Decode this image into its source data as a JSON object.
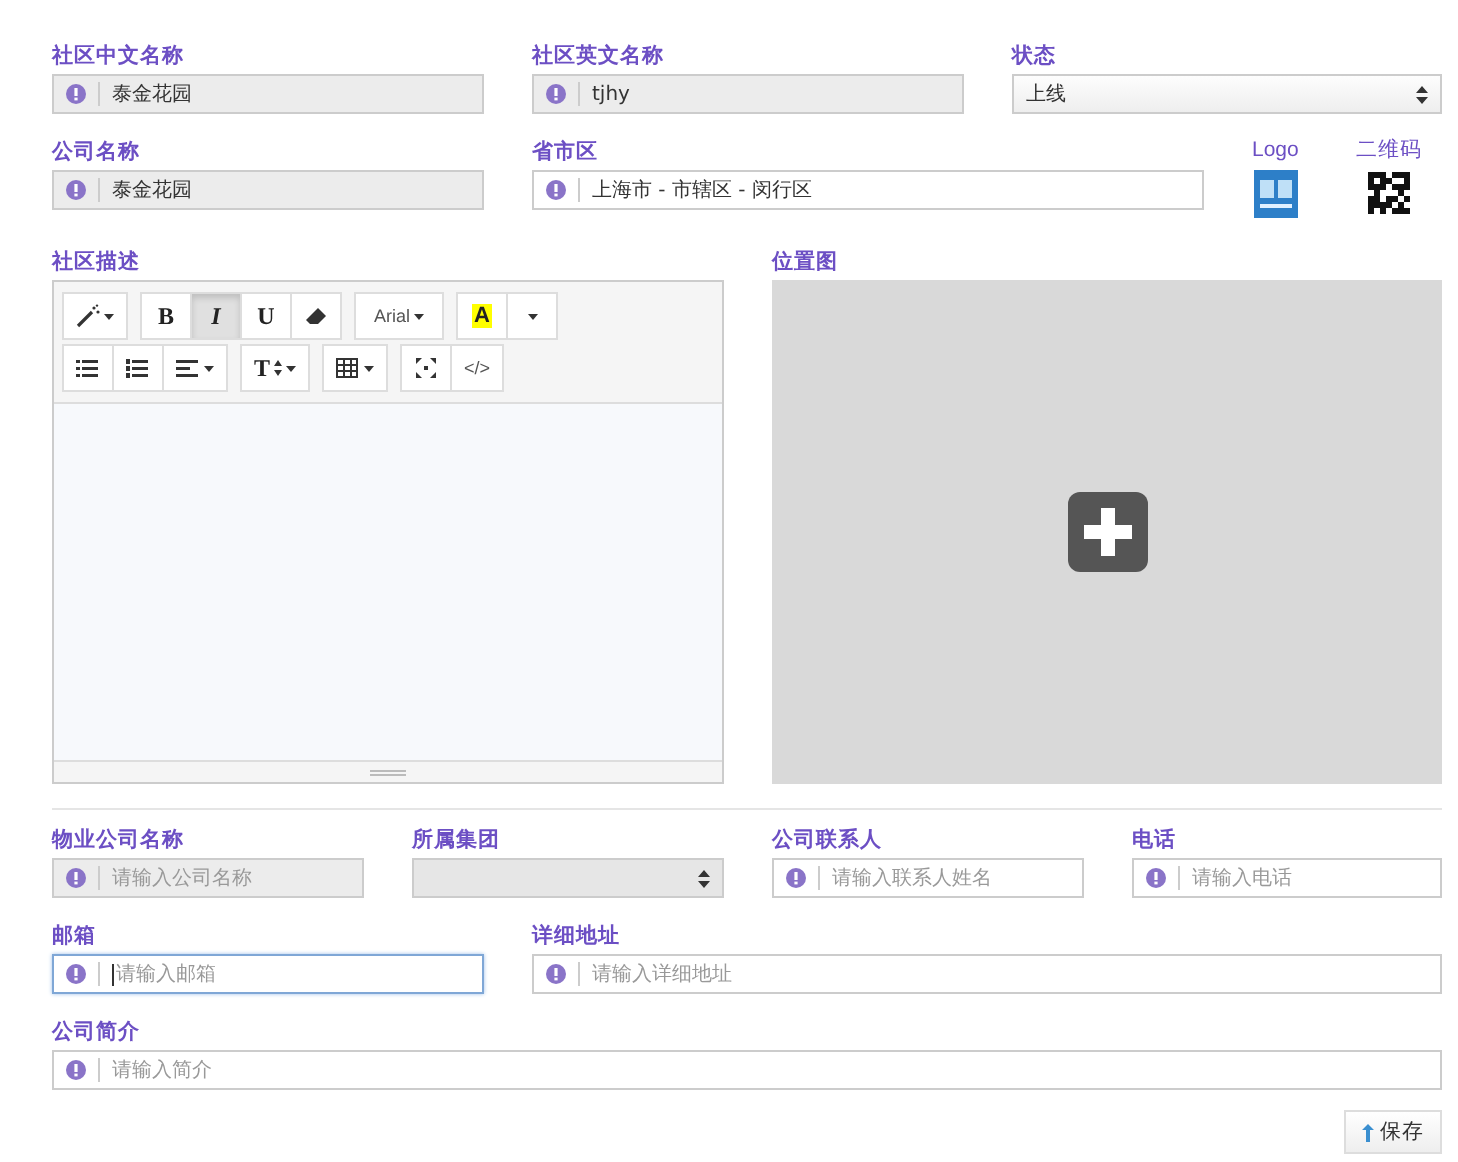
{
  "basic_info": [
    {
      "label": "社区中文名称",
      "kind": "text",
      "value": "泰金花园",
      "disabled": true
    },
    {
      "label": "社区英文名称",
      "kind": "text",
      "value": "tjhy",
      "disabled": true
    },
    {
      "label": "状态",
      "kind": "select",
      "value": "上线",
      "disabled": false
    },
    {
      "label": "公司名称",
      "kind": "text",
      "value": "泰金花园",
      "disabled": true
    },
    {
      "label": "省市区",
      "kind": "text",
      "value": "上海市 - 市辖区 - 闵行区",
      "disabled": false
    }
  ],
  "images": [
    {
      "label": "Logo",
      "kind": "logo"
    },
    {
      "label": "二维码",
      "kind": "qr"
    }
  ],
  "description": {
    "label": "社区描述",
    "toolbar": [
      [
        [
          {
            "kind": "wand",
            "dropdown": true,
            "selected": false
          }
        ],
        [
          {
            "kind": "bold",
            "text": "B",
            "selected": false
          },
          {
            "kind": "italic",
            "text": "I",
            "selected": true
          },
          {
            "kind": "underline",
            "text": "U",
            "selected": false
          },
          {
            "kind": "eraser",
            "selected": false
          }
        ],
        [
          {
            "kind": "font",
            "text": "Arial",
            "dropdown": true,
            "selected": false
          }
        ],
        [
          {
            "kind": "highlight",
            "text": "A",
            "selected": false
          },
          {
            "kind": "caret",
            "dropdown": true,
            "selected": false
          }
        ]
      ],
      [
        [
          {
            "kind": "ul",
            "selected": false
          },
          {
            "kind": "ol",
            "selected": false
          },
          {
            "kind": "align",
            "dropdown": true,
            "selected": false
          }
        ],
        [
          {
            "kind": "fontsize",
            "text": "T",
            "dropdown": true,
            "selected": false
          }
        ],
        [
          {
            "kind": "table",
            "dropdown": true,
            "selected": false
          }
        ],
        [
          {
            "kind": "fullscreen",
            "selected": false
          },
          {
            "kind": "code",
            "text": "</>",
            "selected": false
          }
        ]
      ]
    ]
  },
  "location_map": {
    "label": "位置图"
  },
  "company_info": [
    {
      "label": "物业公司名称",
      "kind": "text",
      "placeholder": "请输入公司名称",
      "disabled": true,
      "focused": false
    },
    {
      "label": "所属集团",
      "kind": "select",
      "disabled": true
    },
    {
      "label": "公司联系人",
      "kind": "text",
      "placeholder": "请输入联系人姓名",
      "disabled": false,
      "focused": false
    },
    {
      "label": "电话",
      "kind": "text",
      "placeholder": "请输入电话",
      "disabled": false,
      "focused": false
    },
    {
      "label": "邮箱",
      "kind": "text",
      "placeholder": "请输入邮箱",
      "disabled": false,
      "focused": true
    },
    {
      "label": "详细地址",
      "kind": "text",
      "placeholder": "请输入详细地址",
      "disabled": false,
      "focused": false
    },
    {
      "label": "公司简介",
      "kind": "text",
      "placeholder": "请输入简介",
      "disabled": false,
      "focused": false
    }
  ],
  "save_button": {
    "label": "保存"
  }
}
